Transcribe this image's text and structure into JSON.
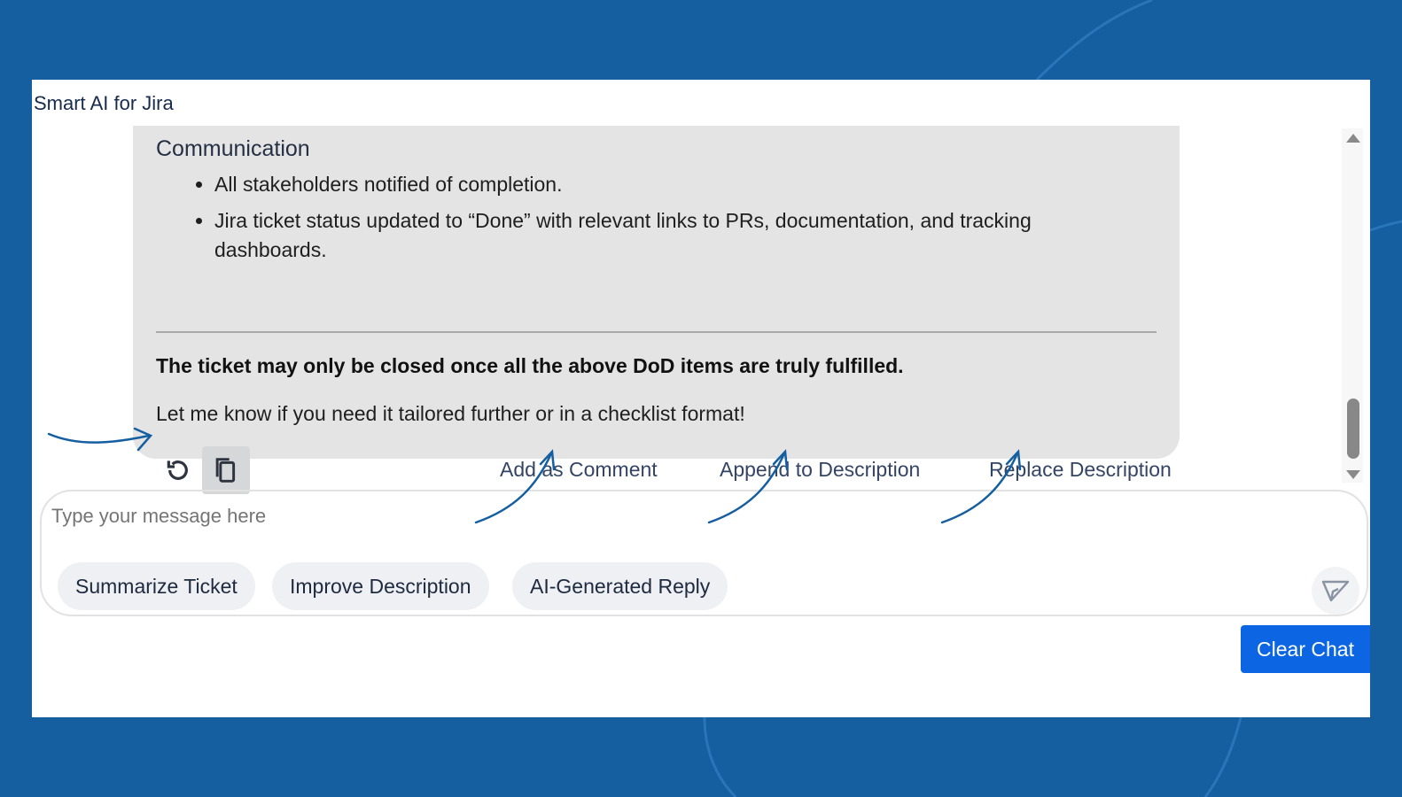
{
  "app": {
    "title": "Smart AI for Jira"
  },
  "message": {
    "heading": "Communication",
    "bullets": [
      "All stakeholders notified of completion.",
      "Jira ticket status updated to “Done” with relevant links to PRs, documentation, and tracking dashboards."
    ],
    "bold_note": "The ticket may only be closed once all the above DoD items are truly fulfilled.",
    "closing": "Let me know if you need it tailored further or in a checklist format!",
    "icons": {
      "regenerate": "refresh-icon",
      "copy": "copy-icon"
    },
    "actions": {
      "add_comment": "Add as Comment",
      "append": "Append to Description",
      "replace": "Replace Description"
    }
  },
  "composer": {
    "placeholder": "Type your message here",
    "chips": [
      "Summarize Ticket",
      "Improve Description",
      "AI-Generated Reply"
    ],
    "send_icon": "send-icon"
  },
  "clear_chat": "Clear Chat",
  "colors": {
    "background": "#155ea0",
    "accent": "#0c66e4",
    "bubble": "#e4e4e4"
  }
}
